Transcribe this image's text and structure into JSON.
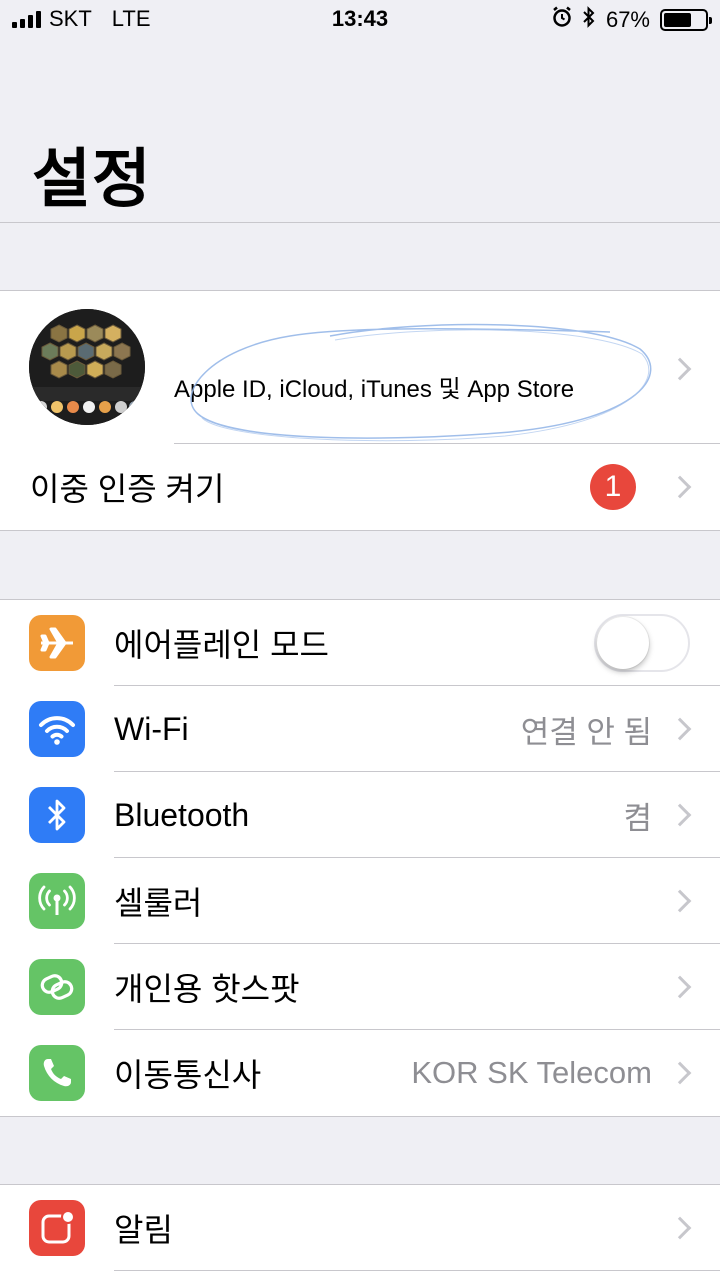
{
  "status": {
    "carrier": "SKT",
    "network": "LTE",
    "time": "13:43",
    "battery": "67%",
    "battery_level": 0.67,
    "icons": [
      "signal-icon",
      "alarm-icon",
      "bluetooth-icon",
      "battery-icon"
    ]
  },
  "title": "설정",
  "profile": {
    "name": "",
    "subtitle": "Apple ID, iCloud, iTunes 및 App Store"
  },
  "two_factor": {
    "label": "이중 인증 켜기",
    "badge": "1"
  },
  "network_group": [
    {
      "label": "에어플레인 모드",
      "icon": "airplane-icon",
      "color": "#f19a37",
      "toggle": false
    },
    {
      "label": "Wi-Fi",
      "value": "연결 안 됨",
      "icon": "wifi-icon",
      "color": "#2f7cf6"
    },
    {
      "label": "Bluetooth",
      "value": "켬",
      "icon": "bluetooth-icon",
      "color": "#2f7cf6"
    },
    {
      "label": "셀룰러",
      "icon": "cellular-icon",
      "color": "#65c466"
    },
    {
      "label": "개인용 핫스팟",
      "icon": "hotspot-icon",
      "color": "#65c466"
    },
    {
      "label": "이동통신사",
      "value": "KOR SK Telecom",
      "icon": "phone-icon",
      "color": "#65c466"
    }
  ],
  "notifications": {
    "label": "알림",
    "icon": "notifications-icon",
    "color": "#e8473c"
  },
  "colors": {
    "background": "#efeff4",
    "separator": "#c8c7cc",
    "badge": "#e8473c",
    "secondary_text": "#8e8e93"
  }
}
